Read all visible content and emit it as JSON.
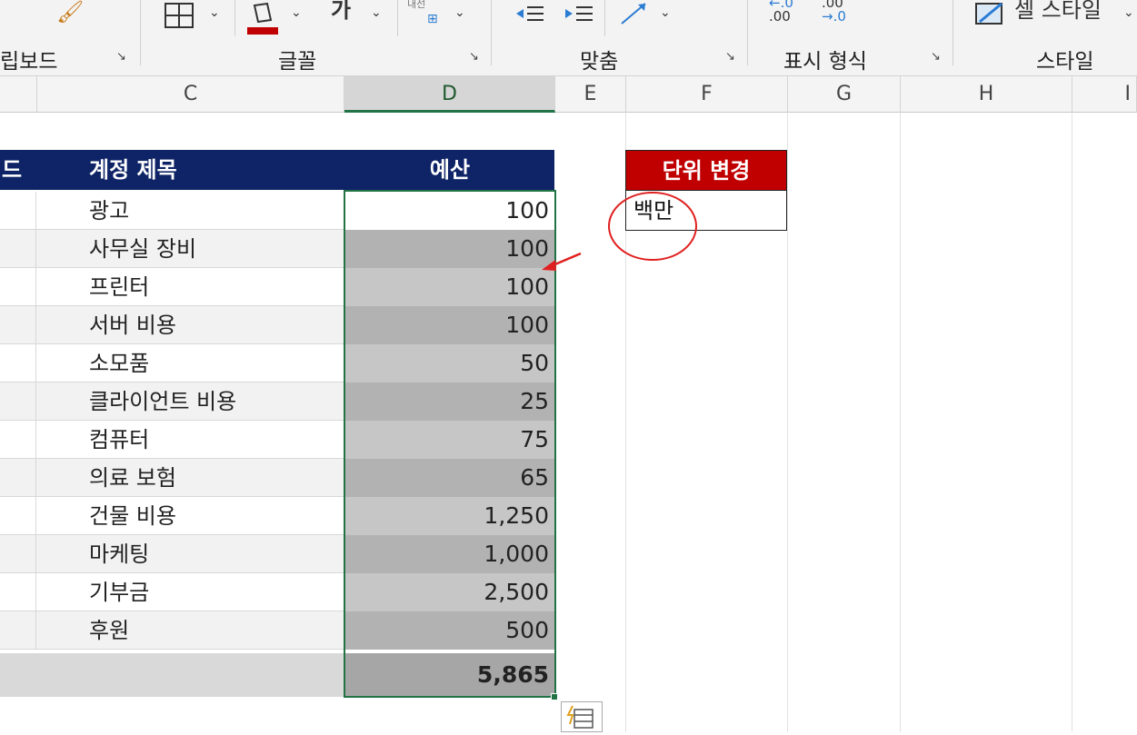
{
  "ribbon": {
    "groups": {
      "clipboard": "립보드",
      "font": "글꼴",
      "alignment": "맞춤",
      "number": "표시 형식",
      "styles": "스타일"
    },
    "font_size_glyph": "가",
    "wrap_text_glyph": "내선",
    "decrease_decimal_top": ".00",
    "decrease_decimal_bottom": "→.0",
    "increase_decimal_top": "←.0",
    "increase_decimal_bottom": ".00",
    "cell_styles_label": "셀 스타일",
    "accent_font_color": "#c00000"
  },
  "columns": [
    "C",
    "D",
    "E",
    "F",
    "G",
    "H",
    "I"
  ],
  "selected_column": "D",
  "table": {
    "partial_header": "드",
    "header_account": "계정 제목",
    "header_budget": "예산",
    "header_color": "#0e2466",
    "rows": [
      {
        "label": "광고",
        "value": "100"
      },
      {
        "label": "사무실 장비",
        "value": "100"
      },
      {
        "label": "프린터",
        "value": "100"
      },
      {
        "label": "서버 비용",
        "value": "100"
      },
      {
        "label": "소모품",
        "value": "50"
      },
      {
        "label": "클라이언트 비용",
        "value": "25"
      },
      {
        "label": "컴퓨터",
        "value": "75"
      },
      {
        "label": "의료 보험",
        "value": "65"
      },
      {
        "label": "건물 비용",
        "value": "1,250"
      },
      {
        "label": "마케팅",
        "value": "1,000"
      },
      {
        "label": "기부금",
        "value": "2,500"
      },
      {
        "label": "후원",
        "value": "500"
      }
    ],
    "total": "5,865"
  },
  "unit_box": {
    "header": "단위 변경",
    "value": "백만",
    "header_color": "#c00000"
  },
  "annotation_color": "#e02020"
}
